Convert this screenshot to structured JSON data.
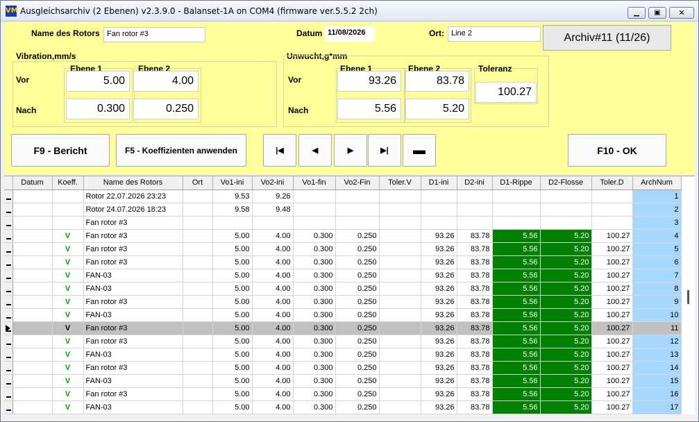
{
  "window": {
    "title": "Ausgleichsarchiv (2 Ebenen) v2.3.9.0 - Balanset-1A on COM4 (firmware ver.5.5.2 2ch)",
    "app_icon_text": "VM"
  },
  "form": {
    "rotor_label": "Name des Rotors",
    "rotor_value": "Fan rotor #3",
    "date_label": "Datum",
    "date_value": "11/08/2026",
    "place_label": "Ort:",
    "place_value": "Line 2",
    "archive_button": "Archiv#11 (11/26)",
    "vibration_group": "Vibration,mm/s",
    "unbalance_group": "Unwucht,g*mm",
    "plane1": "Ebene 1",
    "plane2": "Ebene 2",
    "tolerance_label": "Toleranz",
    "before_label": "Vor",
    "after_label": "Nach",
    "vib_before_p1": "5.00",
    "vib_before_p2": "4.00",
    "vib_after_p1": "0.300",
    "vib_after_p2": "0.250",
    "unb_before_p1": "93.26",
    "unb_before_p2": "83.78",
    "unb_after_p1": "5.56",
    "unb_after_p2": "5.20",
    "tolerance_value": "100.27"
  },
  "buttons": {
    "report": "F9 - Bericht",
    "apply_coeffs": "F5 - Koeffizienten anwenden",
    "ok": "F10 - OK",
    "nav_first_icon": "first-record-icon",
    "nav_prev_icon": "prev-record-icon",
    "nav_next_icon": "next-record-icon",
    "nav_last_icon": "last-record-icon",
    "nav_delete_icon": "delete-record-icon"
  },
  "grid": {
    "columns": [
      "Datum",
      "Koeff.",
      "Name des Rotors",
      "Ort",
      "Vo1-ini",
      "Vo2-ini",
      "Vo1-fin",
      "Vo2-Fin",
      "Toler.V",
      "D1-ini",
      "D2-ini",
      "D1-Rippe",
      "D2-Flosse",
      "Toler.D",
      "ArchNum"
    ],
    "selected_index": 10,
    "rows": [
      [
        "",
        "",
        "Rotor 22.07.2026 23:23",
        "",
        "9.53",
        "9.26",
        "",
        "",
        "",
        "",
        "",
        "",
        "",
        "",
        "1"
      ],
      [
        "",
        "",
        "Rotor 24.07.2026 18:23",
        "",
        "9.58",
        "9.48",
        "",
        "",
        "",
        "",
        "",
        "",
        "",
        "",
        "2"
      ],
      [
        "",
        "",
        "Fan rotor #3",
        "",
        "",
        "",
        "",
        "",
        "",
        "",
        "",
        "",
        "",
        "",
        "3"
      ],
      [
        "",
        "V",
        "Fan rotor #3",
        "",
        "5.00",
        "4.00",
        "0.300",
        "0.250",
        "",
        "93.26",
        "83.78",
        "5.56",
        "5.20",
        "100.27",
        "4"
      ],
      [
        "",
        "V",
        "Fan rotor #3",
        "",
        "5.00",
        "4.00",
        "0.300",
        "0.250",
        "",
        "93.26",
        "83.78",
        "5.56",
        "5.20",
        "100.27",
        "5"
      ],
      [
        "",
        "V",
        "Fan rotor #3",
        "",
        "5.00",
        "4.00",
        "0.300",
        "0.250",
        "",
        "93.26",
        "83.78",
        "5.56",
        "5.20",
        "100.27",
        "6"
      ],
      [
        "",
        "V",
        "FAN-03",
        "",
        "5.00",
        "4.00",
        "0.300",
        "0.250",
        "",
        "93.26",
        "83.78",
        "5.56",
        "5.20",
        "100.27",
        "7"
      ],
      [
        "",
        "V",
        "FAN-03",
        "",
        "5.00",
        "4.00",
        "0.300",
        "0.250",
        "",
        "93.26",
        "83.78",
        "5.56",
        "5.20",
        "100.27",
        "8"
      ],
      [
        "",
        "V",
        "Fan rotor #3",
        "",
        "5.00",
        "4.00",
        "0.300",
        "0.250",
        "",
        "93.26",
        "83.78",
        "5.56",
        "5.20",
        "100.27",
        "9"
      ],
      [
        "",
        "V",
        "FAN-03",
        "",
        "5.00",
        "4.00",
        "0.300",
        "0.250",
        "",
        "93.26",
        "83.78",
        "5.56",
        "5.20",
        "100.27",
        "10"
      ],
      [
        "",
        "V",
        "Fan rotor #3",
        "",
        "5.00",
        "4.00",
        "0.300",
        "0.250",
        "",
        "93.26",
        "83.78",
        "5.56",
        "5.20",
        "100.27",
        "11"
      ],
      [
        "",
        "V",
        "Fan rotor #3",
        "",
        "5.00",
        "4.00",
        "0.300",
        "0.250",
        "",
        "93.26",
        "83.78",
        "5.56",
        "5.20",
        "100.27",
        "12"
      ],
      [
        "",
        "V",
        "FAN-03",
        "",
        "5.00",
        "4.00",
        "0.300",
        "0.250",
        "",
        "93.26",
        "83.78",
        "5.56",
        "5.20",
        "100.27",
        "13"
      ],
      [
        "",
        "V",
        "Fan rotor #3",
        "",
        "5.00",
        "4.00",
        "0.300",
        "0.250",
        "",
        "93.26",
        "83.78",
        "5.56",
        "5.20",
        "100.27",
        "14"
      ],
      [
        "",
        "V",
        "FAN-03",
        "",
        "5.00",
        "4.00",
        "0.300",
        "0.250",
        "",
        "93.26",
        "83.78",
        "5.56",
        "5.20",
        "100.27",
        "15"
      ],
      [
        "",
        "V",
        "Fan rotor #3",
        "",
        "5.00",
        "4.00",
        "0.300",
        "0.250",
        "",
        "93.26",
        "83.78",
        "5.56",
        "5.20",
        "100.27",
        "16"
      ],
      [
        "",
        "V",
        "FAN-03",
        "",
        "5.00",
        "4.00",
        "0.300",
        "0.250",
        "",
        "93.26",
        "83.78",
        "5.56",
        "5.20",
        "100.27",
        "17"
      ]
    ]
  },
  "colors": {
    "form_background": "#ffff99",
    "result_green": "#008000",
    "archnum_blue": "#a6d7ff",
    "selected_row": "#c0c0c0",
    "coeff_green": "#00a000"
  }
}
